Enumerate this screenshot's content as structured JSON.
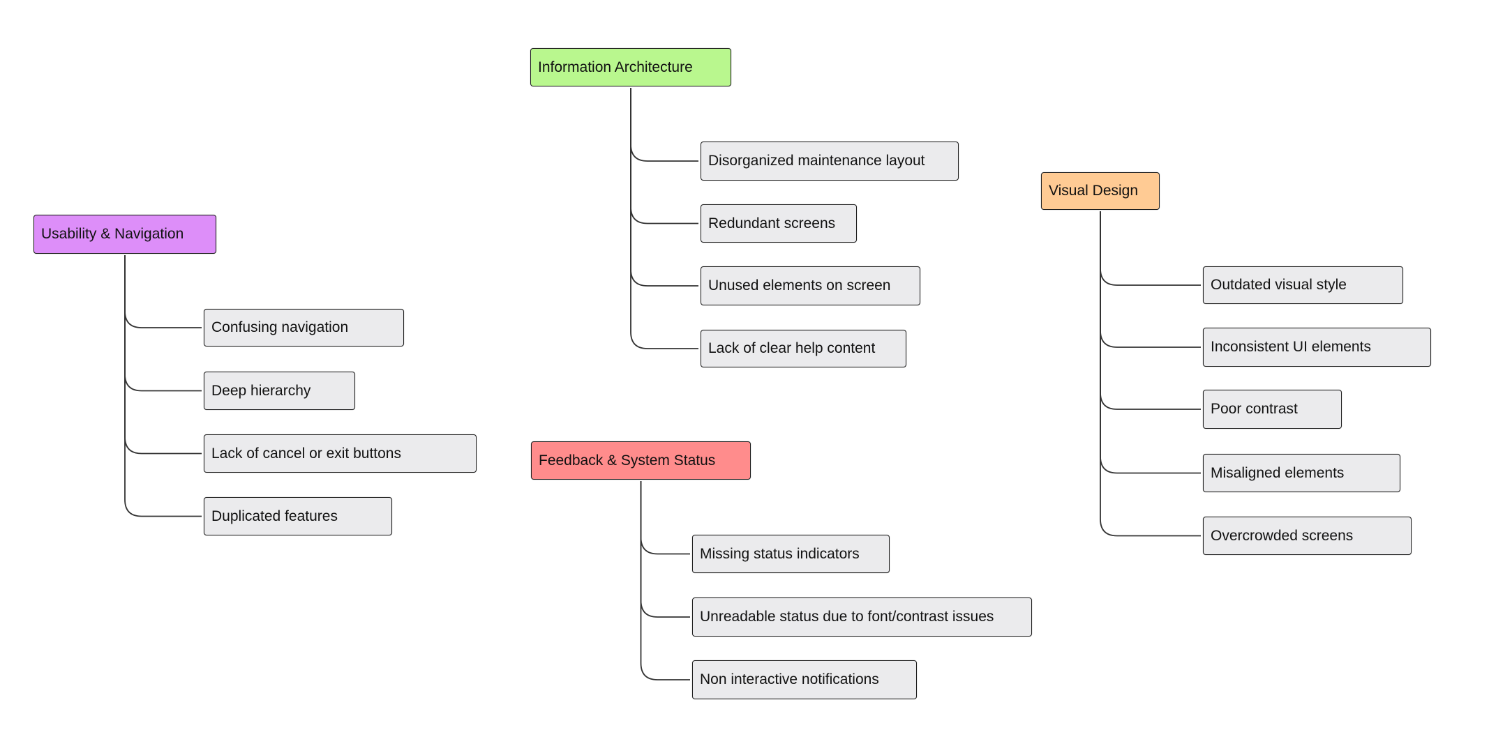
{
  "diagram": {
    "type": "mind-map / affinity groups",
    "groups": [
      {
        "id": "usability",
        "title": "Usability & Navigation",
        "color": "#dd8ef9",
        "items": [
          "Confusing navigation",
          "Deep hierarchy",
          "Lack of cancel or exit buttons",
          "Duplicated features"
        ]
      },
      {
        "id": "information-architecture",
        "title": "Information Architecture",
        "color": "#b9f78e",
        "items": [
          "Disorganized maintenance layout",
          "Redundant screens",
          "Unused elements on screen",
          "Lack of clear help content"
        ]
      },
      {
        "id": "feedback",
        "title": "Feedback & System Status",
        "color": "#ff8c8c",
        "items": [
          "Missing status indicators",
          "Unreadable status due to font/contrast issues",
          "Non interactive notifications"
        ]
      },
      {
        "id": "visual-design",
        "title": "Visual Design",
        "color": "#ffcb94",
        "items": [
          "Outdated visual style",
          "Inconsistent UI elements",
          "Poor contrast",
          "Misaligned elements",
          "Overcrowded screens"
        ]
      }
    ],
    "child_color": "#ebebed",
    "connector_color": "#333333"
  }
}
